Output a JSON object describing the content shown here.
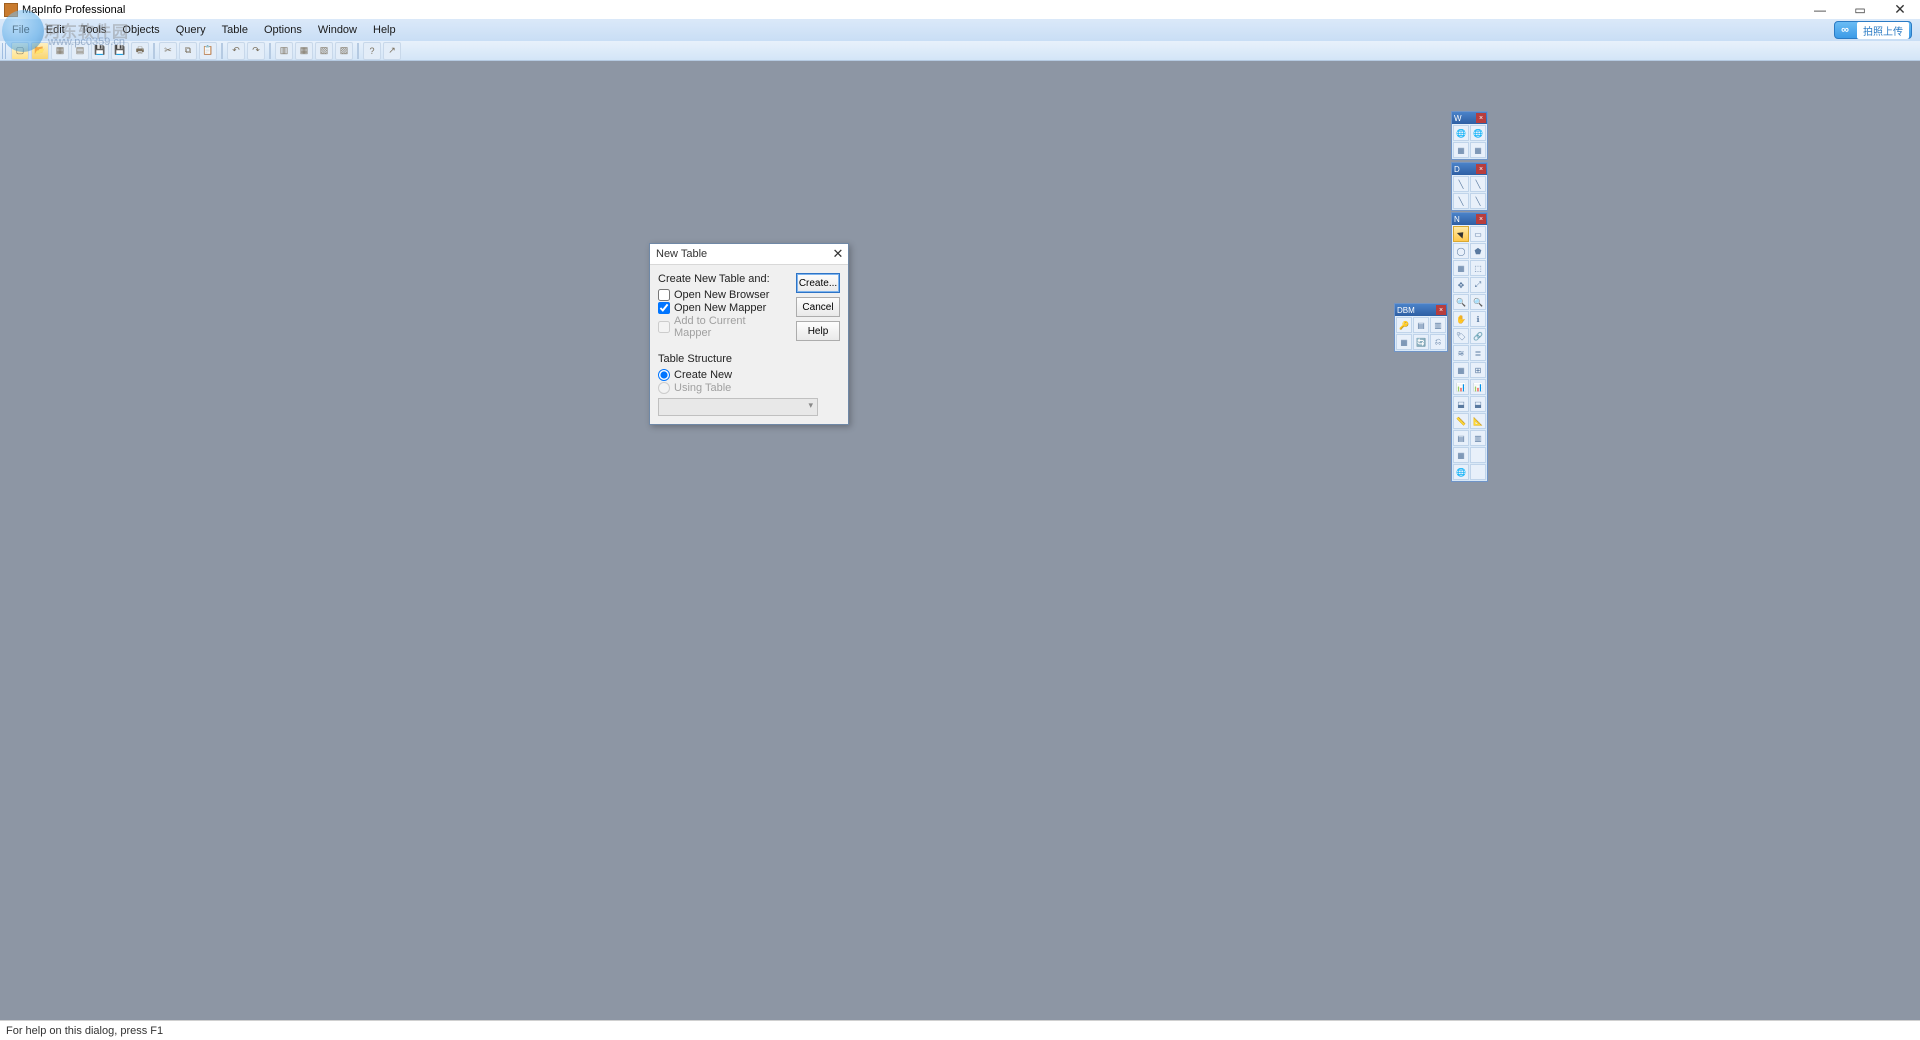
{
  "app": {
    "title": "MapInfo Professional",
    "statusbar": "For help on this dialog, press F1"
  },
  "watermark": {
    "line1": "河东软件园",
    "line2": "www.pc0359.cn"
  },
  "menu": {
    "items": [
      "File",
      "Edit",
      "Tools",
      "Objects",
      "Query",
      "Table",
      "Options",
      "Window",
      "Help"
    ]
  },
  "right_tag": {
    "label": "拍照上传"
  },
  "toolbar_icons": [
    "new",
    "open",
    "save",
    "print",
    "cut",
    "copy",
    "paste",
    "undo",
    "redo",
    "a",
    "b",
    "c",
    "d",
    "e",
    "f",
    "g",
    "h",
    "i",
    "j"
  ],
  "dialog": {
    "title": "New Table",
    "group1_label": "Create New Table and:",
    "chk1": "Open New Browser",
    "chk2": "Open New Mapper",
    "chk3": "Add to Current Mapper",
    "group2_label": "Table Structure",
    "radio1": "Create New",
    "radio2": "Using Table",
    "btn_create": "Create...",
    "btn_cancel": "Cancel",
    "btn_help": "Help",
    "close": "✕"
  },
  "palettes": {
    "w": {
      "title": "W"
    },
    "d": {
      "title": "D"
    },
    "n": {
      "title": "N"
    },
    "dbm": {
      "title": "DBM"
    }
  },
  "win_controls": {
    "min": "—",
    "max": "▭",
    "close": "✕"
  }
}
